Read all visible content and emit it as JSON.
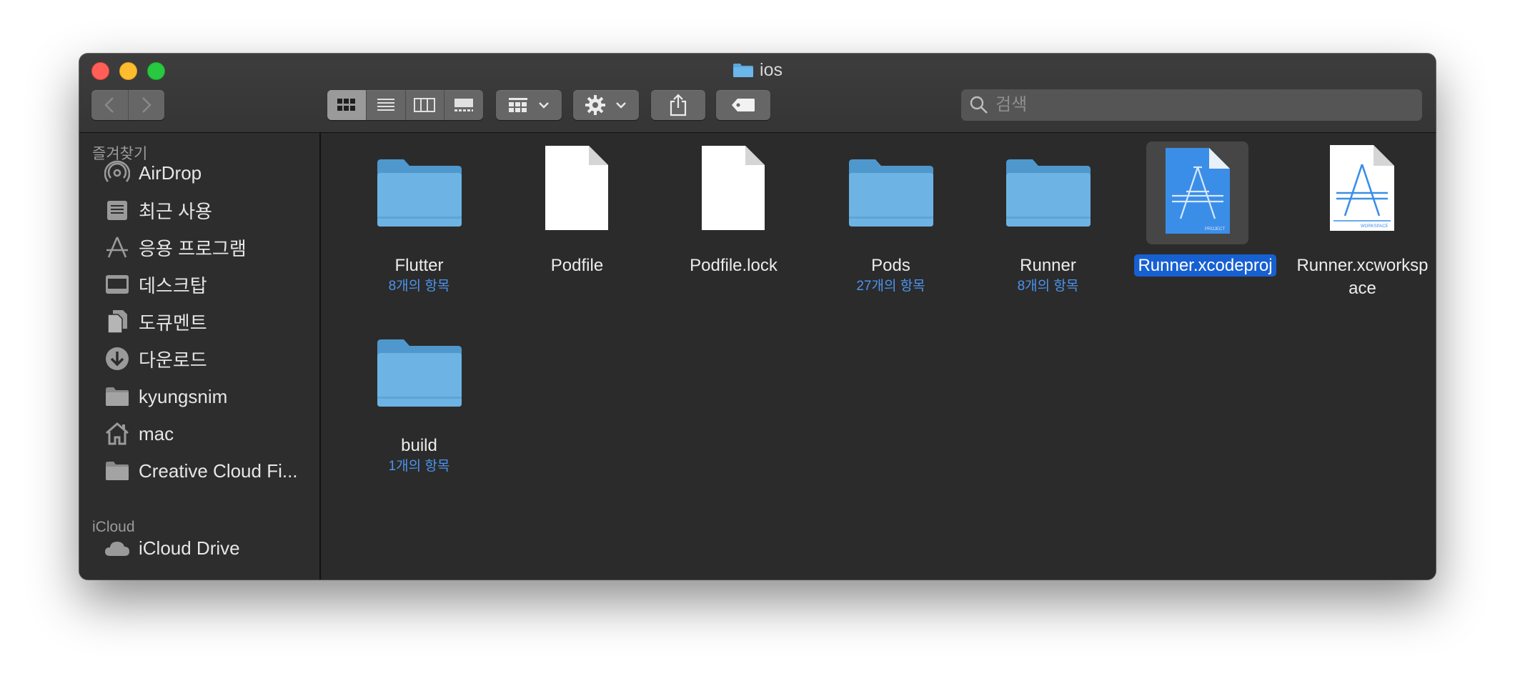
{
  "window": {
    "title": "ios"
  },
  "toolbar": {
    "back": "back",
    "forward": "forward",
    "view_modes": [
      "icon-view",
      "list-view",
      "column-view",
      "gallery-view"
    ],
    "search_placeholder": "검색"
  },
  "sidebar": {
    "favorites_title": "즐겨찾기",
    "favorites": [
      {
        "label": "AirDrop",
        "icon": "airdrop-icon"
      },
      {
        "label": "최근 사용",
        "icon": "recents-icon"
      },
      {
        "label": "응용 프로그램",
        "icon": "applications-icon"
      },
      {
        "label": "데스크탑",
        "icon": "desktop-icon"
      },
      {
        "label": "도큐멘트",
        "icon": "document-icon"
      },
      {
        "label": "다운로드",
        "icon": "download-icon"
      },
      {
        "label": "kyungsnim",
        "icon": "folder-icon"
      },
      {
        "label": "mac",
        "icon": "home-icon"
      },
      {
        "label": "Creative Cloud Fi...",
        "icon": "folder-icon"
      }
    ],
    "icloud_title": "iCloud",
    "icloud": [
      {
        "label": "iCloud Drive",
        "icon": "cloud-icon"
      }
    ]
  },
  "files": [
    {
      "name": "Flutter",
      "sub": "8개의 항목",
      "type": "folder"
    },
    {
      "name": "Podfile",
      "sub": "",
      "type": "document"
    },
    {
      "name": "Podfile.lock",
      "sub": "",
      "type": "document"
    },
    {
      "name": "Pods",
      "sub": "27개의 항목",
      "type": "folder"
    },
    {
      "name": "Runner",
      "sub": "8개의 항목",
      "type": "folder"
    },
    {
      "name": "Runner.xcodeproj",
      "sub": "",
      "type": "xcodeproj",
      "selected": true
    },
    {
      "name": "Runner.xcworkspace",
      "line1": "Runner.xcworksp",
      "line2": "ace",
      "sub": "",
      "type": "xcworkspace"
    },
    {
      "name": "build",
      "sub": "1개의 항목",
      "type": "folder"
    }
  ],
  "colors": {
    "accent": "#1760d2",
    "folder": "#6bb3e6",
    "subtext": "#4b94ee"
  }
}
